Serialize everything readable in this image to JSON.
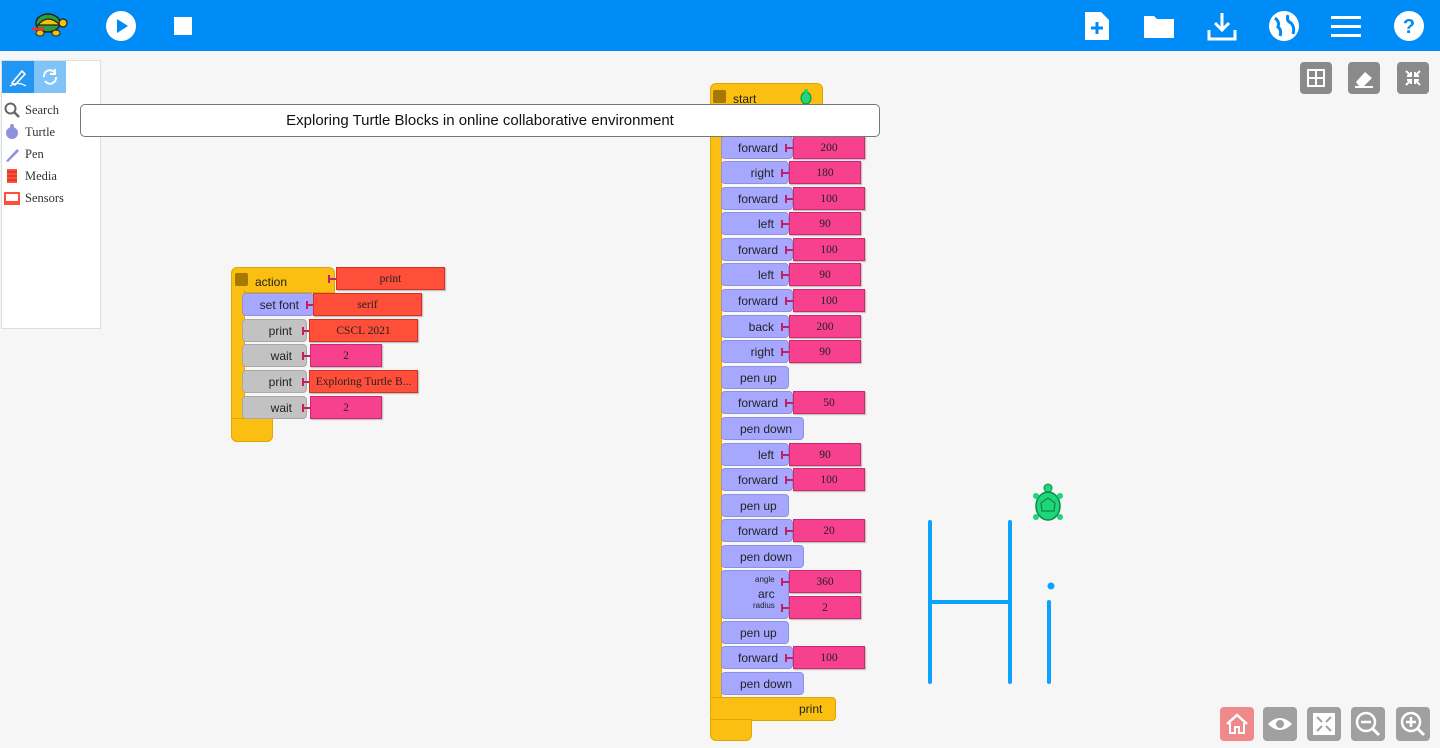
{
  "toolbar": {
    "left_icons": [
      "turtle-logo-icon",
      "play-icon",
      "stop-icon"
    ],
    "right_icons": [
      "new-project-icon",
      "open-folder-icon",
      "save-download-icon",
      "language-globe-icon",
      "menu-icon",
      "help-icon"
    ]
  },
  "palette": {
    "tabs": [
      "pen-blocks-tab-icon",
      "refresh-tab-icon"
    ],
    "items": [
      {
        "label": "Search",
        "icon": "search-icon",
        "color": "#777777"
      },
      {
        "label": "Turtle",
        "icon": "turtle-icon",
        "color": "#8e90e0"
      },
      {
        "label": "Pen",
        "icon": "pen-icon",
        "color": "#8e90e0"
      },
      {
        "label": "Media",
        "icon": "media-icon",
        "color": "#ff4f3a"
      },
      {
        "label": "Sensors",
        "icon": "sensors-icon",
        "color": "#ff4f3a"
      }
    ]
  },
  "title_text": "Exploring Turtle Blocks in online collaborative environment",
  "action_stack": {
    "header": "action",
    "name_arg": "print",
    "blocks": [
      {
        "label": "set font",
        "arg": "serif",
        "arg_color": "red"
      },
      {
        "label": "print",
        "arg": "CSCL 2021",
        "arg_color": "red"
      },
      {
        "label": "wait",
        "arg": "2",
        "arg_color": "pink"
      },
      {
        "label": "print",
        "arg": "Exploring Turtle B...",
        "arg_color": "red"
      },
      {
        "label": "wait",
        "arg": "2",
        "arg_color": "pink"
      }
    ]
  },
  "start_stack": {
    "header": "start",
    "blocks": [
      {
        "label": "forward",
        "arg": "200"
      },
      {
        "label": "right",
        "arg": "180"
      },
      {
        "label": "forward",
        "arg": "100"
      },
      {
        "label": "left",
        "arg": "90"
      },
      {
        "label": "forward",
        "arg": "100"
      },
      {
        "label": "left",
        "arg": "90"
      },
      {
        "label": "forward",
        "arg": "100"
      },
      {
        "label": "back",
        "arg": "200"
      },
      {
        "label": "right",
        "arg": "90"
      },
      {
        "label": "pen up",
        "arg": null
      },
      {
        "label": "forward",
        "arg": "50"
      },
      {
        "label": "pen down",
        "arg": null
      },
      {
        "label": "left",
        "arg": "90"
      },
      {
        "label": "forward",
        "arg": "100"
      },
      {
        "label": "pen up",
        "arg": null
      },
      {
        "label": "forward",
        "arg": "20"
      },
      {
        "label": "pen down",
        "arg": null
      }
    ],
    "arc": {
      "label": "arc",
      "angle_label": "angle",
      "radius_label": "radius",
      "angle": "360",
      "radius": "2"
    },
    "after": [
      {
        "label": "pen up",
        "arg": null
      },
      {
        "label": "forward",
        "arg": "100"
      },
      {
        "label": "pen down",
        "arg": null
      }
    ],
    "footer_call": "print"
  },
  "canvas_controls": [
    "grid-icon",
    "eraser-clear-icon",
    "collapse-icon"
  ],
  "bottom_controls": [
    "home-icon",
    "show-hide-blocks-icon",
    "expand-collapse-blocks-icon",
    "zoom-out-icon",
    "zoom-in-icon"
  ],
  "colors": {
    "toolbar": "#008cf7",
    "flow_block": "#a6a8ff",
    "number_arg": "#f7418f",
    "text_arg": "#ff4f3a",
    "clamp": "#fabf10",
    "drawing": "#0aa3ff",
    "turtle": "#1fd67a"
  }
}
